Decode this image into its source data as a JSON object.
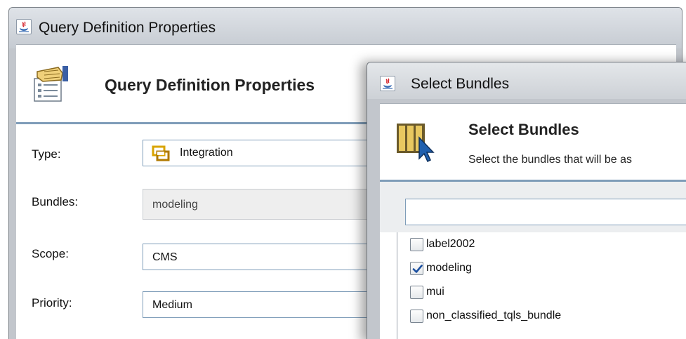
{
  "main_dialog": {
    "window_title": "Query Definition Properties",
    "header_title": "Query Definition Properties",
    "fields": {
      "type": {
        "label": "Type:",
        "value": "Integration"
      },
      "bundles": {
        "label": "Bundles:",
        "value": "modeling"
      },
      "scope": {
        "label": "Scope:",
        "value": "CMS"
      },
      "priority": {
        "label": "Priority:",
        "value": "Medium"
      }
    }
  },
  "bundles_dialog": {
    "window_title": "Select Bundles",
    "header_title": "Select Bundles",
    "header_subtitle": "Select the bundles that will be as",
    "search": {
      "value": ""
    },
    "items": [
      {
        "label": "label2002",
        "checked": false
      },
      {
        "label": "modeling",
        "checked": true
      },
      {
        "label": "mui",
        "checked": false
      },
      {
        "label": "non_classified_tqls_bundle",
        "checked": false
      }
    ]
  },
  "colors": {
    "separator": "#7f9db9",
    "checkmark": "#1a4fa0",
    "integration_icon": "#d9a400"
  }
}
